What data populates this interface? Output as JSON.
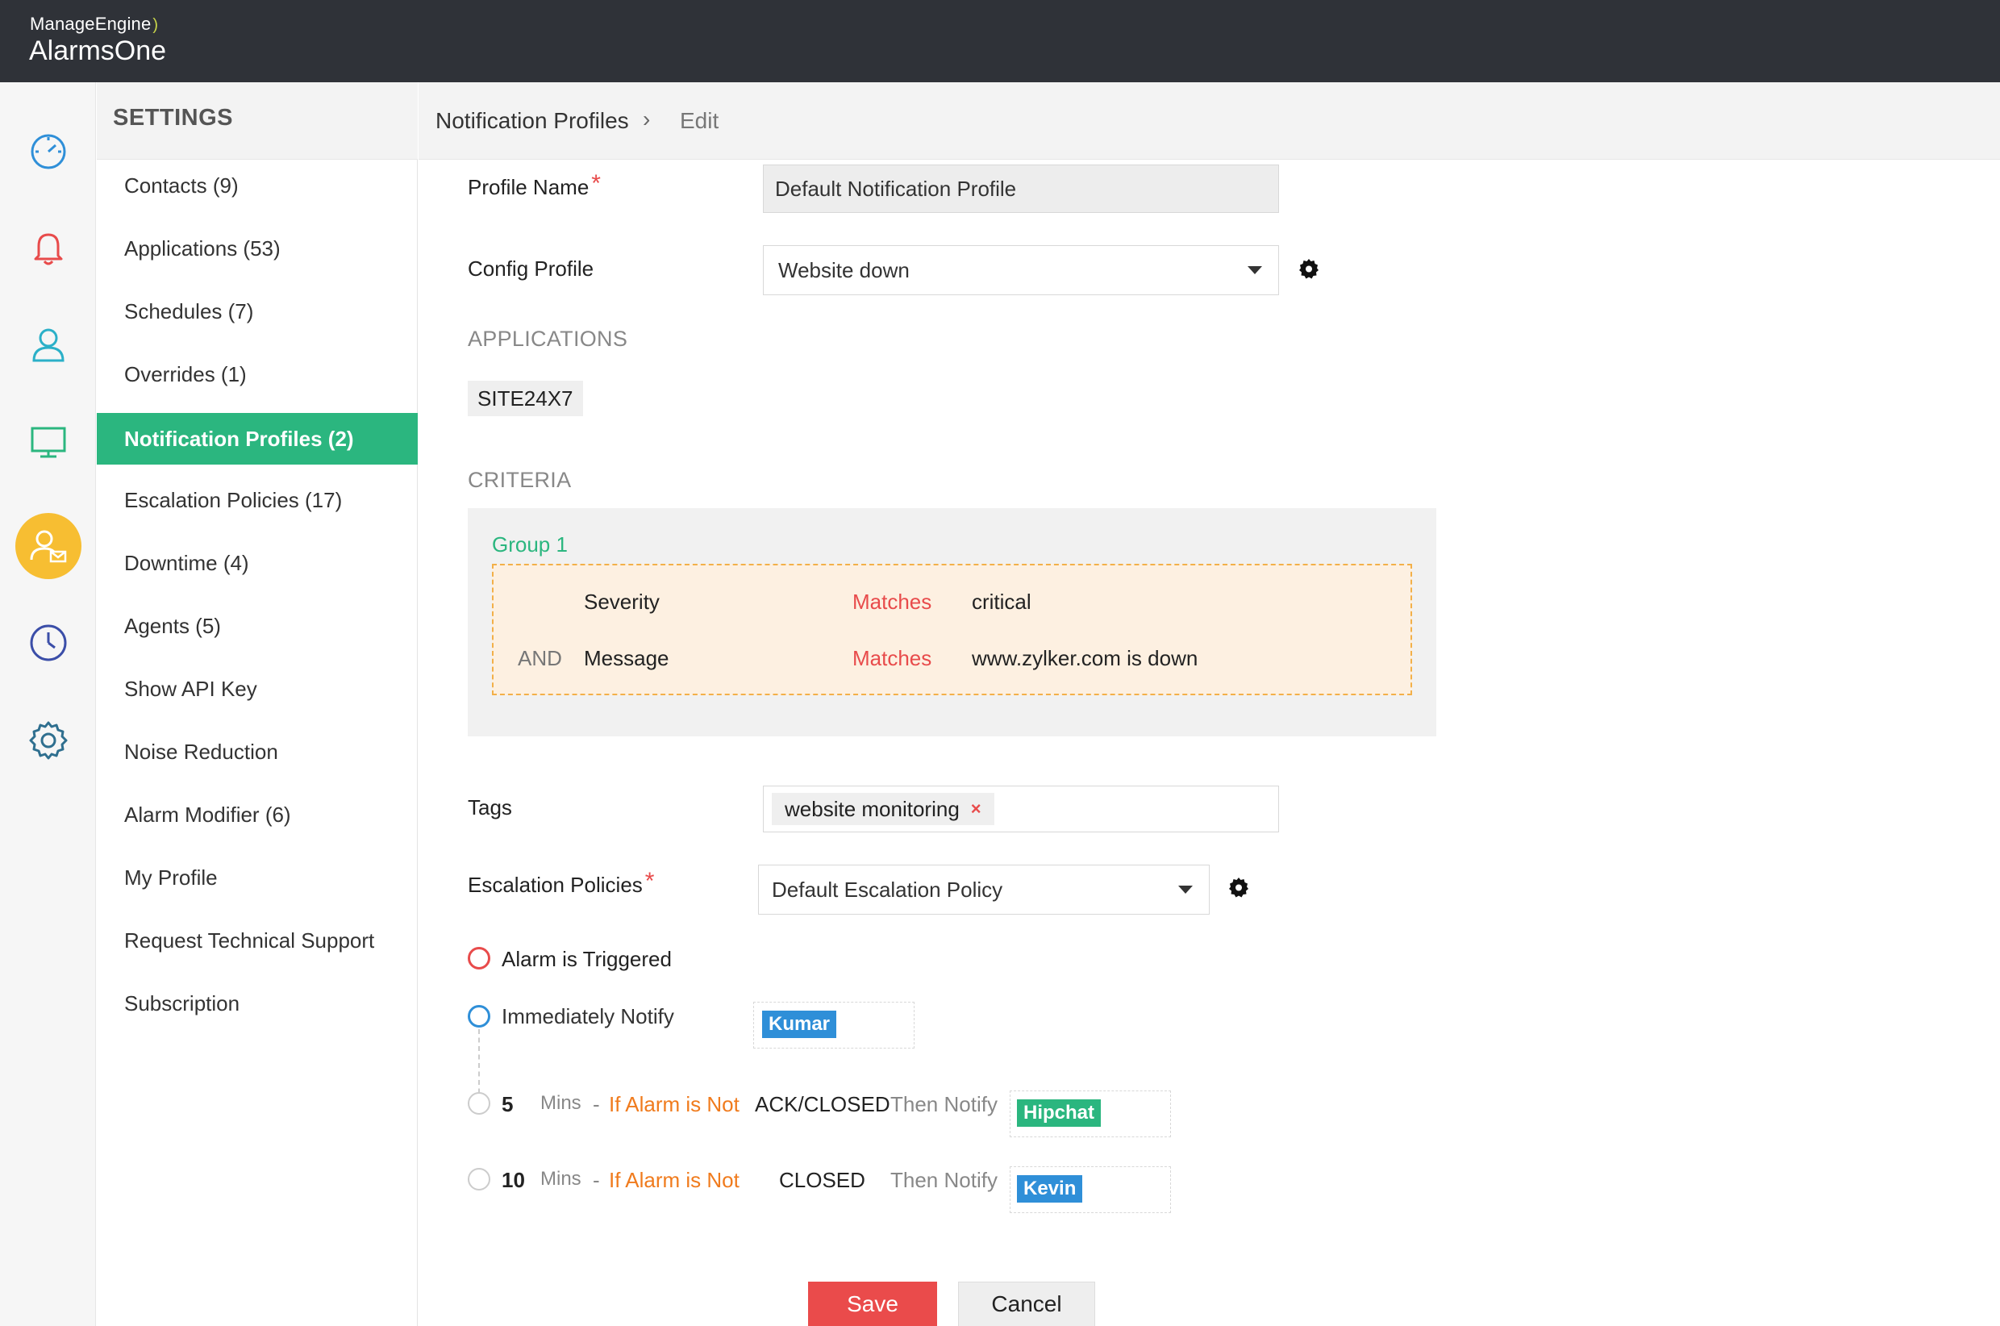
{
  "header": {
    "brand_small": "ManageEngine",
    "brand_big": "AlarmsOne"
  },
  "rail": {
    "icons": [
      "dashboard-icon",
      "bell-icon",
      "user-icon",
      "monitor-icon",
      "contact-mail-icon",
      "clock-icon",
      "gear-icon"
    ],
    "active": "contact-mail-icon"
  },
  "settings": {
    "title": "SETTINGS",
    "items": [
      "Contacts (9)",
      "Applications (53)",
      "Schedules (7)",
      "Overrides (1)",
      "Notification Profiles (2)",
      "Escalation Policies (17)",
      "Downtime (4)",
      "Agents (5)",
      "Show API Key",
      "Noise Reduction",
      "Alarm Modifier (6)",
      "My Profile",
      "Request Technical Support",
      "Subscription"
    ],
    "active_index": 4
  },
  "breadcrumb": {
    "parent": "Notification Profiles",
    "separator": "›",
    "current": "Edit"
  },
  "form": {
    "profile_name_label": "Profile Name",
    "profile_name_value": "Default Notification Profile",
    "required_mark": "*",
    "config_profile_label": "Config Profile",
    "config_profile_value": "Website down",
    "applications_heading": "APPLICATIONS",
    "application_chip": "SITE24X7",
    "criteria_heading": "CRITERIA",
    "criteria": {
      "group_label": "Group 1",
      "rows": [
        {
          "connector": "",
          "field": "Severity",
          "operator": "Matches",
          "value": "critical"
        },
        {
          "connector": "AND",
          "field": "Message",
          "operator": "Matches",
          "value": "www.zylker.com is down"
        }
      ]
    },
    "tags_label": "Tags",
    "tag_chip": "website monitoring",
    "tag_remove": "×",
    "escalation_label": "Escalation Policies",
    "escalation_value": "Default Escalation Policy"
  },
  "escalation": {
    "triggered": "Alarm is Triggered",
    "immediately": "Immediately Notify",
    "immediate_recipient": "Kumar",
    "steps": [
      {
        "minutes": "5",
        "unit": "Mins",
        "dash": "-",
        "condition": "If Alarm is Not",
        "state": "ACK/CLOSED",
        "then": "Then Notify",
        "recipient": "Hipchat"
      },
      {
        "minutes": "10",
        "unit": "Mins",
        "dash": "-",
        "condition": "If Alarm is Not",
        "state": "CLOSED",
        "then": "Then Notify",
        "recipient": "Kevin"
      }
    ]
  },
  "buttons": {
    "save": "Save",
    "cancel": "Cancel"
  },
  "colors": {
    "header": "#2f3238",
    "accent_green": "#2bb67f",
    "red": "#e84b4b",
    "orange": "#f07b1d",
    "blue_badge": "#2f8fd8",
    "yellow_active": "#f7be32"
  }
}
